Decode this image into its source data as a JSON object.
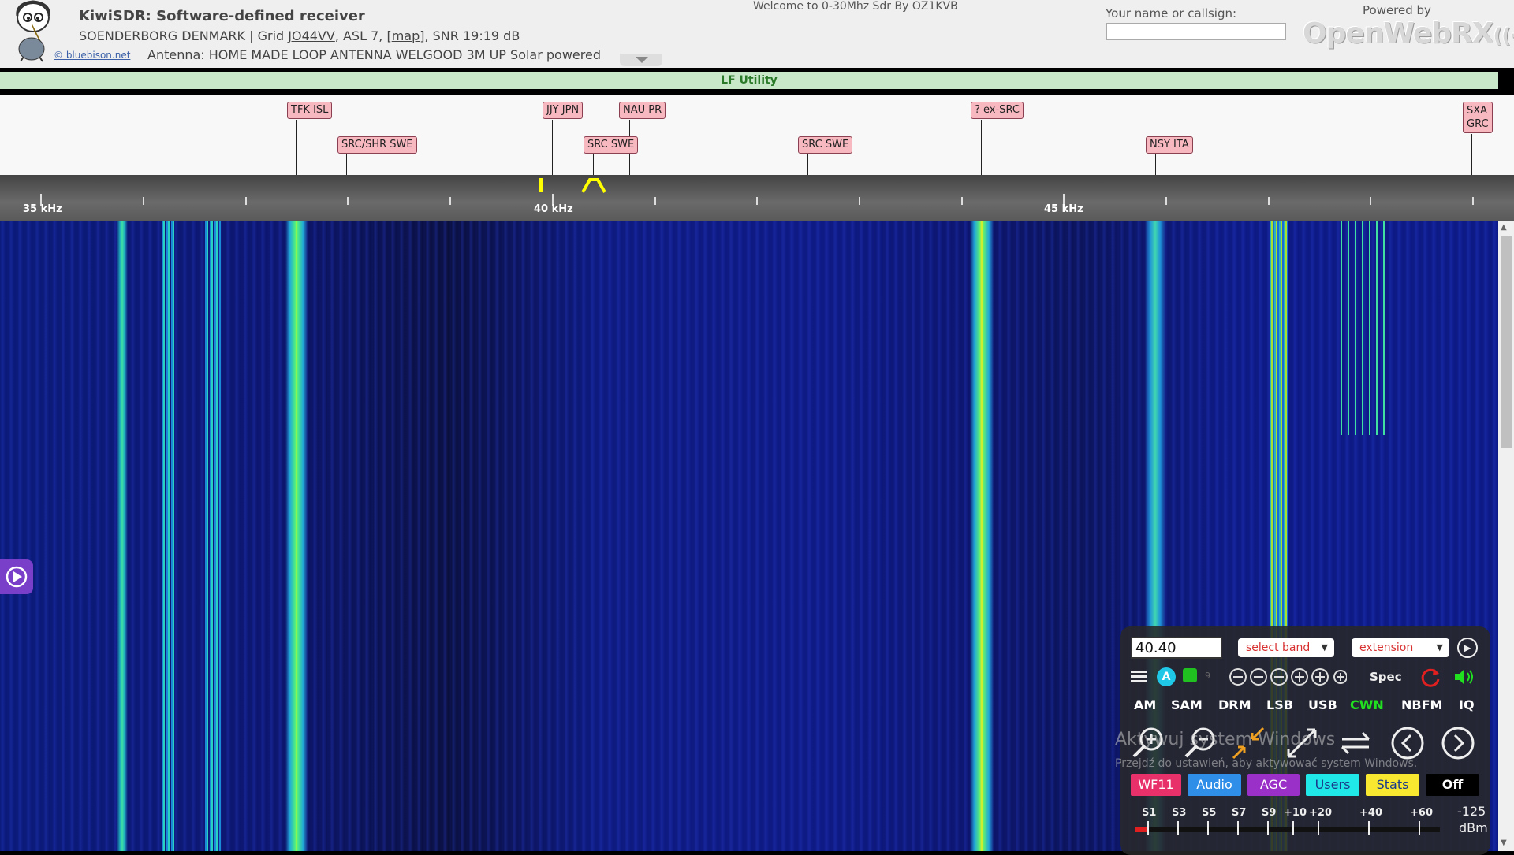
{
  "header": {
    "title": "KiwiSDR: Software-defined receiver",
    "location_prefix": "SOENDERBORG DENMARK | Grid ",
    "grid": "JO44VV",
    "location_mid": ", ASL 7, [",
    "map_link": "map",
    "location_suffix": "], SNR 19:19 dB",
    "credit": "© bluebison.net",
    "antenna": "Antenna: HOME MADE LOOP ANTENNA WELGOOD 3M UP Solar powered",
    "welcome": "Welcome to 0-30Mhz Sdr By OZ1KVB",
    "name_label": "Your name or callsign:",
    "name_value": "",
    "powered_by": "Powered by",
    "powered_logo": "OpenWebRX"
  },
  "band_bar": {
    "label": "LF Utility"
  },
  "stations": [
    {
      "label": "TFK ISL"
    },
    {
      "label": "SRC/SHR SWE"
    },
    {
      "label": "JJY JPN"
    },
    {
      "label": "NAU PR"
    },
    {
      "label": "SRC SWE"
    },
    {
      "label": "SRC SWE"
    },
    {
      "label": "? ex-SRC"
    },
    {
      "label": "NSY ITA"
    },
    {
      "label": "SXA"
    },
    {
      "label": "GRC"
    }
  ],
  "scale": {
    "labels": [
      "35 kHz",
      "40 kHz",
      "45 kHz"
    ]
  },
  "controls": {
    "frequency": "40.40",
    "band_select": "select band",
    "extension_select": "extension",
    "spec_label": "Spec",
    "agc_icon_letter": "A",
    "modes": [
      "AM",
      "SAM",
      "DRM",
      "LSB",
      "USB",
      "CWN",
      "NBFM",
      "IQ"
    ],
    "active_mode": "CWN",
    "tabs": [
      {
        "label": "WF11",
        "bg": "#e8306a",
        "fg": "#ffffff"
      },
      {
        "label": "Audio",
        "bg": "#2f8fe8",
        "fg": "#ffffff"
      },
      {
        "label": "AGC",
        "bg": "#9a30c8",
        "fg": "#ffffff"
      },
      {
        "label": "Users",
        "bg": "#20e8e8",
        "fg": "#1a3a8a"
      },
      {
        "label": "Stats",
        "bg": "#f8e830",
        "fg": "#1a3a8a"
      },
      {
        "label": "Off",
        "bg": "#000000",
        "fg": "#ffffff"
      }
    ],
    "smeter_labels": [
      "S1",
      "S3",
      "S5",
      "S7",
      "S9",
      "+10",
      "+20",
      "+40",
      "+60"
    ],
    "smeter_level": 0.04,
    "dbm_value": "-125",
    "dbm_unit": "dBm"
  },
  "watermark": {
    "line1": "Aktywuj system Windows",
    "line2": "Przejdź do ustawień, aby aktywować system Windows."
  },
  "colors": {
    "accent_green": "#20e020",
    "mode_active": "#20e020",
    "reload_red": "#e02020"
  }
}
